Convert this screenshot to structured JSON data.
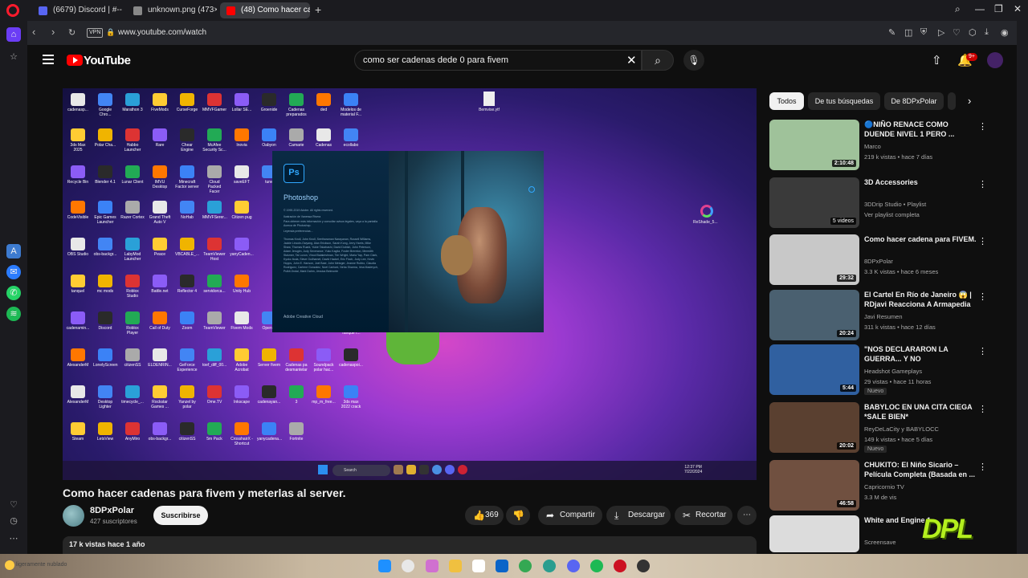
{
  "tabs": [
    {
      "label": "(6679) Discord | #-- | citi",
      "favicon_color": "#5865f2"
    },
    {
      "label": "unknown.png (473×287)",
      "favicon_color": "#888888"
    },
    {
      "label": "(48) Como hacer cadenas",
      "favicon_color": "#ff0000"
    }
  ],
  "address": {
    "vpn": "VPN",
    "url": "www.youtube.com/watch"
  },
  "youtube": {
    "logo": "YouTube",
    "search_query": "como ser cadenas dede 0 para fivem",
    "notif_badge": "9+"
  },
  "desktop": {
    "icons": [
      [
        "cadenasp...",
        "Google Chro...",
        "Marathon 3",
        "FiveMods",
        "CurseForge",
        "MMVFGamer",
        "Lollar SE...",
        "Groenide",
        "Cadenas preparados",
        "ded",
        "Modelos de materiaI F..."
      ],
      [
        "3ds Max 2025",
        "Polar Cha...",
        "Habbo Launcher",
        "Rare",
        "Chear Engine",
        "McAfee Security Sc...",
        "Inovia",
        "Oabyon",
        "Camarie",
        "Cadenas",
        "ecollabo"
      ],
      [
        "Recycle Bin",
        "Blender 4.1",
        "Lunar Client",
        "IMVU Desktop",
        "Minecraft Factor server",
        "Cloud Packed Facer",
        "saveEFT",
        "tune"
      ],
      [
        "CodeVisible",
        "Epic Games Launcher",
        "Razer Cortex",
        "Grand Theft Auto V",
        "NoHab",
        "MMVFSerer...",
        "Citizen pug"
      ],
      [
        "OBS Studio",
        "obs-backgr...",
        "LabyMod Launcher",
        "Peace",
        "VBCABLE_...",
        "TeamViewer Host",
        "yanyCaden..."
      ],
      [
        "tanquel",
        "mc mods",
        "Roblox Studio",
        "Battle.net",
        "Reflector 4",
        "servidorca...",
        "Unity Hub"
      ],
      [
        "cadenamin...",
        "Discord",
        "Roblox Player",
        "Call of Duty",
        "Zoom",
        "TeamViewer",
        "Fivem Mods",
        "OpenIV",
        "FiveM",
        "Audacity",
        "cadena Tanque I..."
      ],
      [
        "AlexanderM",
        "LonelyScreen",
        "citizenSS",
        "ELDENRIN...",
        "GeForce Experience",
        "toef_diff_00...",
        "Adobe Acrobat",
        "Server fivem",
        "Cadenas pa desmantelar",
        "Soundpack polar hac...",
        "cadenaspoi..."
      ],
      [
        "AlexanderM",
        "Desktop Lighter",
        "timecycle_...",
        "Rockstar Games ...",
        "Yanzel by polar",
        "Ome.TV",
        "Inkscape",
        "cadenayan...",
        "3",
        "mp_m_free...",
        "3ds max 2022 crack"
      ],
      [
        "Steam",
        "LetsView",
        "AnyMiro",
        "obs-backgr...",
        "citizenSS",
        "5m Pack",
        "CrosshairX - Shortcut",
        "yanycadena...",
        "Fortnite"
      ]
    ],
    "file_top": "Bemvise.ytf",
    "reshade": "ReShade_5...",
    "taskbar_search": "Search",
    "clock_time": "12:37 PM",
    "clock_date": "7/22/2024"
  },
  "photoshop": {
    "badge": "Ps",
    "name": "Photoshop",
    "copyright": "© 1990-2019 Adobe. All rights reserved.",
    "illustration": "Ilustración de Vanessa Rivera",
    "legal": "Para obtener más información y consultar avisos legales, vaya a la pantalla Acerca de Photoshop.",
    "credits": "Thomas Knoll, John Knoll, Seetharaman Narayanan, Russell Williams, Jackie Lincoln-Owyang, Alan Erickson, Sarah Kong, Jerry Harris, Mike Shaw, Thomas Ruark, Yukie Takahashi, David Dobish, John Peterson, Adam Jerugim, Judy Severance, Yuko Kagita, Foster Brereton, Meredith Stotzner, Tai Luxon, Vinod Balakrishnan, Tim Wright, Maria Yap, Pam Clark, Kyoko Itoda, Steve Guilhamet, David Hackel, Eric Floch, Judy Lee, Kevin Hopps, John E. Hanson, Joel Baer, John Metzger, Jeanne Rubbo, Claudia Rodriguez, Carlene Gonzalez, Noel Carboni, Neha Sharma, Irina Maderych, Pulkit Jindal, Mark Dahm, Jessica Belmonte",
    "legal_more": "Leyenda preferencias...",
    "creative_cloud": "Adobe Creative Cloud"
  },
  "video": {
    "title": "Como hacer cadenas para fivem y meterlas al server.",
    "channel": "8DPxPolar",
    "subscribers": "427 suscriptores",
    "subscribe": "Suscribirse",
    "likes": "369",
    "share": "Compartir",
    "download": "Descargar",
    "clip": "Recortar",
    "meta": "17 k vistas  hace 1 año"
  },
  "chips": [
    "Todos",
    "De tus búsquedas",
    "De 8DPxPolar"
  ],
  "recommendations": [
    {
      "title": "🔵NIÑO RENACE COMO DUENDE NIVEL 1 PERO ...",
      "channel": "Marco",
      "stats": "219 k vistas • hace 7 días",
      "duration": "2:10:48",
      "thumb": "#9fc29a"
    },
    {
      "title": "3D Accessories",
      "channel": "3DDrip Studio • Playlist",
      "stats": "Ver playlist completa",
      "duration": "5 videos",
      "thumb": "#3a3a3a"
    },
    {
      "title": "Como hacer cadena para FIVEM.",
      "channel": "8DPxPolar",
      "stats": "3.3 K vistas • hace 6 meses",
      "duration": "29:32",
      "thumb": "#c8c8c8"
    },
    {
      "title": "El Cartel En Río de Janeiro 😱 | RDjavi Reacciona A Armapedia",
      "channel": "Javi Resumen",
      "stats": "311 k vistas • hace 12 días",
      "duration": "20:24",
      "thumb": "#4a6070"
    },
    {
      "title": "\"NOS DECLARARON LA GUERRA... Y NO PERDONAMO...",
      "channel": "Headshot Gameplays",
      "stats": "29 vistas • hace 11 horas",
      "duration": "5:44",
      "badge": "Nuevo",
      "thumb": "#3060a0"
    },
    {
      "title": "BABYLOC EN UNA CITA CIEGA *SALE BIEN*",
      "channel": "ReyDeLaCity  y BABYLOCC",
      "stats": "149 k vistas • hace 5 días",
      "duration": "20:02",
      "badge": "Nuevo",
      "thumb": "#5a4030"
    },
    {
      "title": "CHUKITO: El Niño Sicario – Película Completa (Basada en ...",
      "channel": "Capricornio TV",
      "stats": "3.3 M de vis",
      "duration": "46:58",
      "thumb": "#705040"
    },
    {
      "title": "White and Engine 1",
      "channel": "Screensave",
      "stats": "",
      "duration": "",
      "thumb": "#dcdcdc"
    }
  ],
  "watermark": "DPL",
  "os": {
    "weather": "ligeramente nublado"
  }
}
